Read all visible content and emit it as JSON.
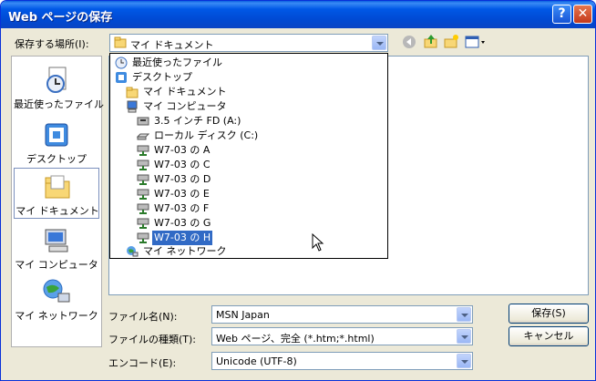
{
  "window": {
    "title": "Web ページの保存",
    "help_label": "?",
    "close_label": "✕"
  },
  "location": {
    "label": "保存する場所(I):",
    "value": "マイ ドキュメント"
  },
  "places": [
    {
      "label": "最近使ったファイル",
      "icon": "recent-files-icon"
    },
    {
      "label": "デスクトップ",
      "icon": "desktop-icon"
    },
    {
      "label": "マイ ドキュメント",
      "icon": "my-documents-icon"
    },
    {
      "label": "マイ コンピュータ",
      "icon": "my-computer-icon"
    },
    {
      "label": "マイ ネットワーク",
      "icon": "my-network-icon"
    }
  ],
  "dropdown": [
    {
      "label": "最近使ったファイル",
      "icon": "recent-files-icon"
    },
    {
      "label": "デスクトップ",
      "icon": "desktop-icon"
    },
    {
      "label": "マイ ドキュメント",
      "icon": "my-documents-icon"
    },
    {
      "label": "マイ コンピュータ",
      "icon": "my-computer-icon"
    },
    {
      "label": "3.5 インチ FD (A:)",
      "icon": "floppy-drive-icon"
    },
    {
      "label": "ローカル ディスク (C:)",
      "icon": "local-disk-icon"
    },
    {
      "label": "W7-03 の A",
      "icon": "network-drive-icon"
    },
    {
      "label": "W7-03 の C",
      "icon": "network-drive-icon"
    },
    {
      "label": "W7-03 の D",
      "icon": "network-drive-icon"
    },
    {
      "label": "W7-03 の E",
      "icon": "network-drive-icon"
    },
    {
      "label": "W7-03 の F",
      "icon": "network-drive-icon"
    },
    {
      "label": "W7-03 の G",
      "icon": "network-drive-icon"
    },
    {
      "label": "W7-03 の H",
      "icon": "network-drive-icon"
    },
    {
      "label": "マイ ネットワーク",
      "icon": "my-network-icon"
    }
  ],
  "form": {
    "filename_label": "ファイル名(N):",
    "filename_value": "MSN Japan",
    "filetype_label": "ファイルの種類(T):",
    "filetype_value": "Web ページ、完全 (*.htm;*.html)",
    "encoding_label": "エンコード(E):",
    "encoding_value": "Unicode (UTF-8)"
  },
  "buttons": {
    "save": "保存(S)",
    "cancel": "キャンセル"
  },
  "colors": {
    "titlebar": "#0058e6",
    "selection": "#316ac5",
    "dialog_bg": "#ece9d8"
  }
}
